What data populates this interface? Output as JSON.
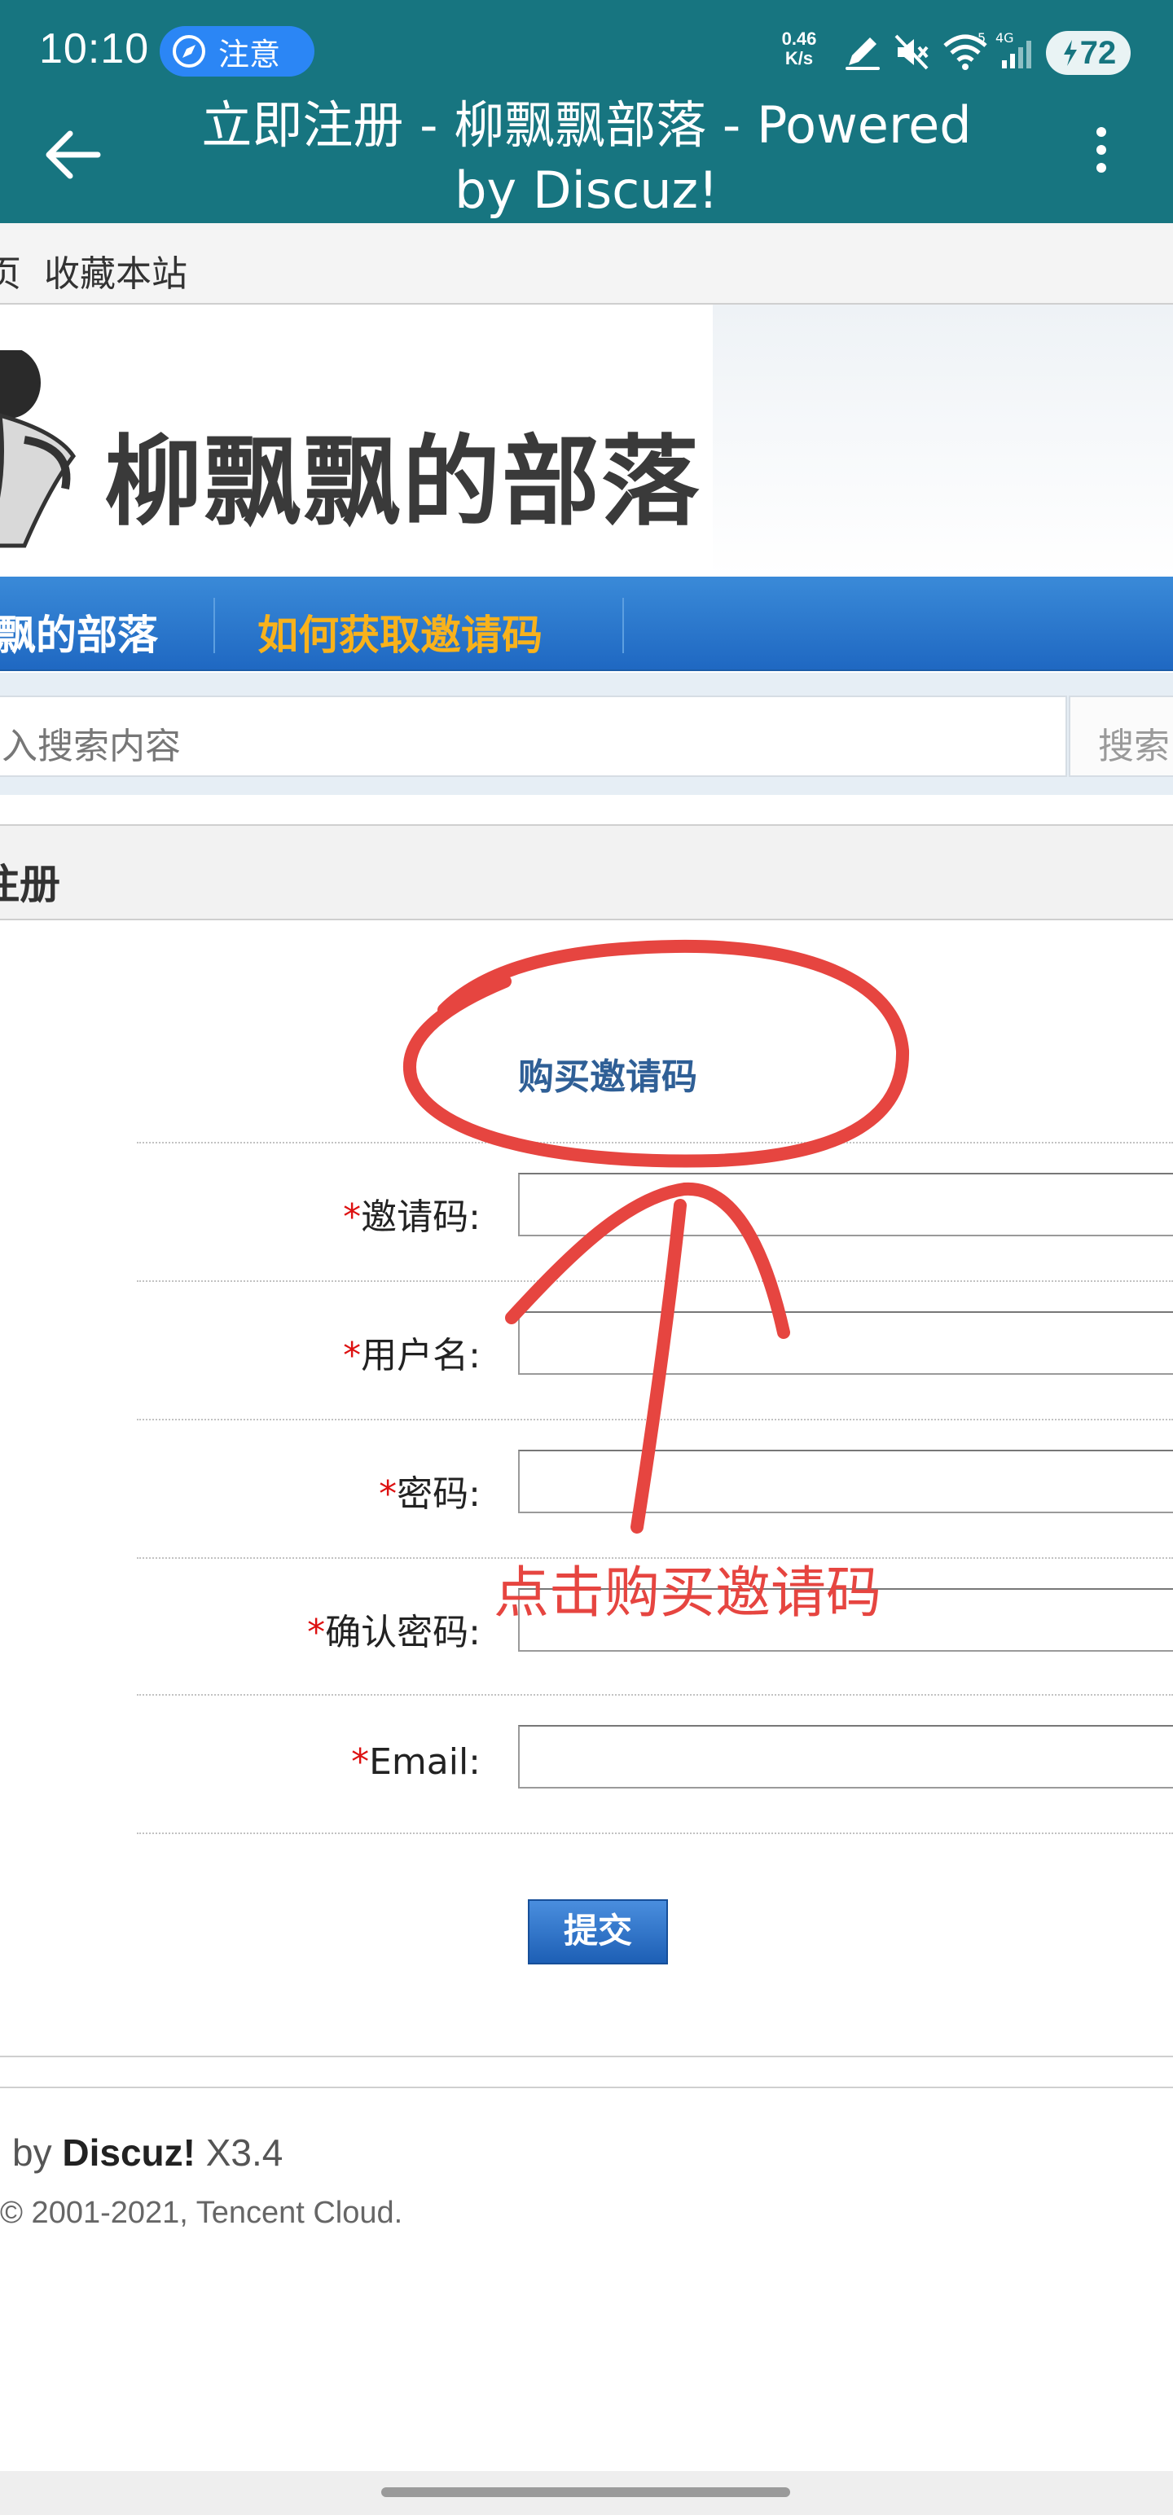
{
  "status_bar": {
    "time": "10:10",
    "notice_label": "注意",
    "net_speed": "0.46",
    "net_unit": "K/s",
    "wifi_label": "5",
    "signal_label": "4G",
    "battery": "72"
  },
  "app_bar": {
    "title": "立即注册 - 柳飘飘部落 - Powered by Discuz!",
    "background": "#177580"
  },
  "top_links": {
    "home_partial": "页",
    "bookmark": "收藏本站"
  },
  "logo": {
    "text": "柳飘飘的部落"
  },
  "nav": {
    "items": [
      {
        "label": "飘的部落",
        "color": "#ffffff"
      },
      {
        "label": "如何获取邀请码",
        "color": "#f8b21c"
      }
    ]
  },
  "search": {
    "placeholder": "入搜索内容",
    "button": "搜索"
  },
  "register": {
    "header": "注册",
    "buy_invite_link": "购买邀请码",
    "fields": [
      {
        "label": "邀请码:",
        "required": "*"
      },
      {
        "label": "用户名:",
        "required": "*"
      },
      {
        "label": "密码:",
        "required": "*"
      },
      {
        "label": "确认密码:",
        "required": "*"
      },
      {
        "label": "Email:",
        "required": "*"
      }
    ],
    "submit": "提交"
  },
  "footer": {
    "powered_prefix": "l by ",
    "powered_brand": "Discuz!",
    "powered_version": " X3.4",
    "copyright": "© 2001-2021, Tencent Cloud."
  },
  "annotation": {
    "text": "点击购买邀请码",
    "color": "#e64540"
  },
  "icons": [
    "compass-icon",
    "back-arrow-icon",
    "more-vert-icon",
    "pen-icon",
    "mute-icon",
    "wifi-icon",
    "signal-icon",
    "bolt-icon"
  ]
}
